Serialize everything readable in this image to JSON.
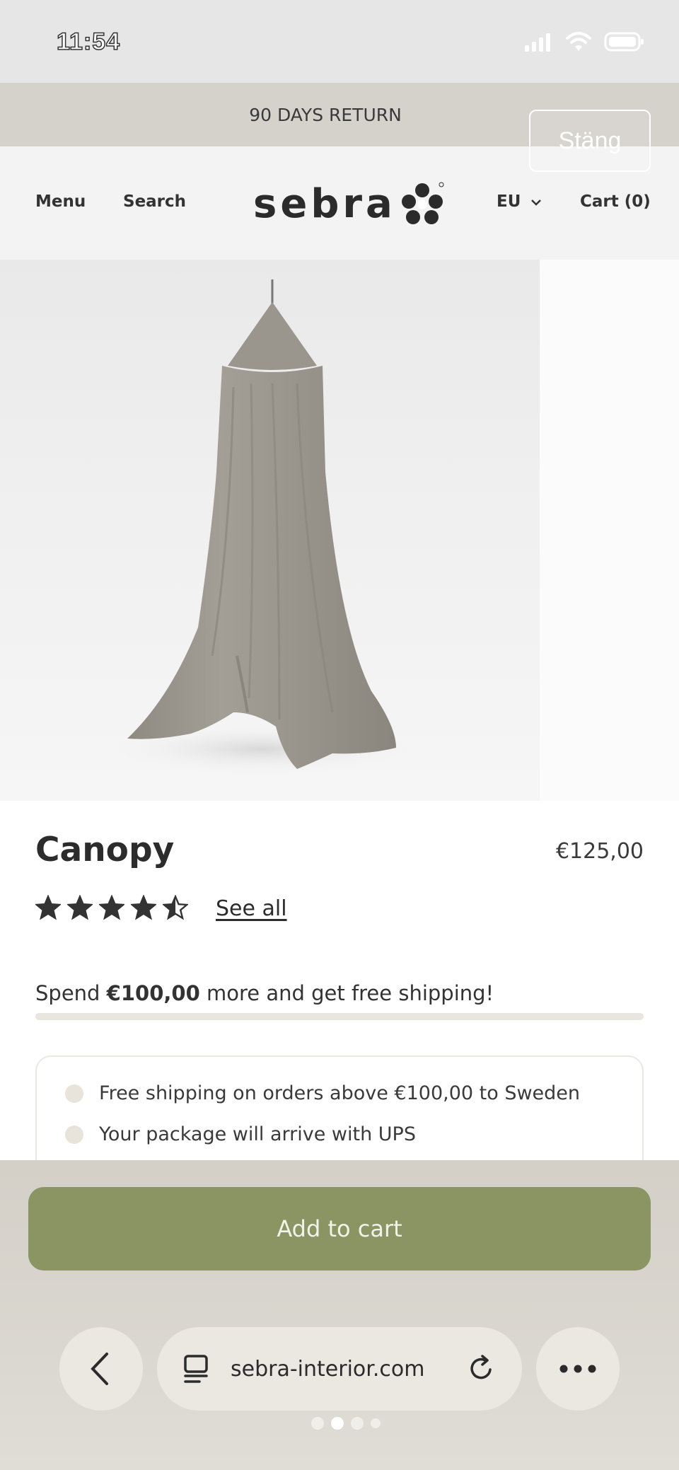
{
  "status_bar": {
    "time": "11:54"
  },
  "promo": {
    "text": "90 DAYS RETURN",
    "close_label": "Stäng"
  },
  "header": {
    "menu_label": "Menu",
    "search_label": "Search",
    "logo_text": "sebra",
    "region_label": "EU",
    "cart_label": "Cart (0)"
  },
  "product": {
    "title": "Canopy",
    "price": "€125,00",
    "rating": 4.5,
    "see_all_label": "See all"
  },
  "shipping": {
    "msg_prefix": "Spend ",
    "msg_amount": "€100,00",
    "msg_suffix": " more and get free shipping!",
    "progress": 0,
    "info_lines": [
      "Free shipping on orders above €100,00 to Sweden",
      "Your package will arrive with UPS"
    ]
  },
  "actions": {
    "add_to_cart_label": "Add to cart"
  },
  "browser": {
    "url": "sebra-interior.com",
    "page_count": 4,
    "active_page": 2
  },
  "colors": {
    "accent": "#8a9563",
    "promo_bg": "#d5d2cc"
  }
}
